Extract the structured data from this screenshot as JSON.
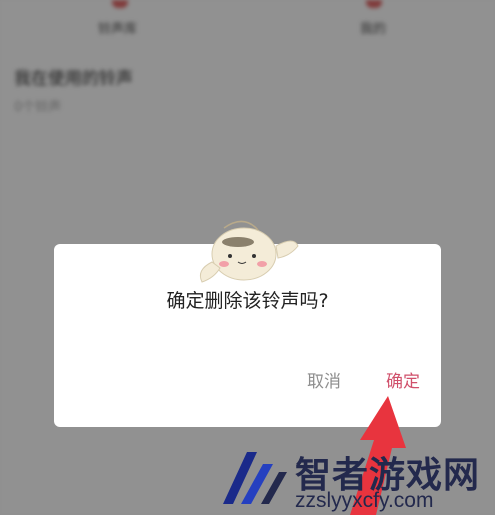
{
  "background": {
    "tabs": [
      {
        "label": "铃声库"
      },
      {
        "label": "我的"
      }
    ],
    "section_title": "我在使用的铃声",
    "section_subtitle": "0个铃声"
  },
  "dialog": {
    "message": "确定删除该铃声吗?",
    "cancel_label": "取消",
    "confirm_label": "确定"
  },
  "watermark": {
    "title": "智者游戏网",
    "url": "zzslyyxcfy.com"
  },
  "colors": {
    "confirm": "#d0506b",
    "cancel": "#8e8e8e",
    "arrow": "#e8343e",
    "watermark": "#23294d"
  }
}
